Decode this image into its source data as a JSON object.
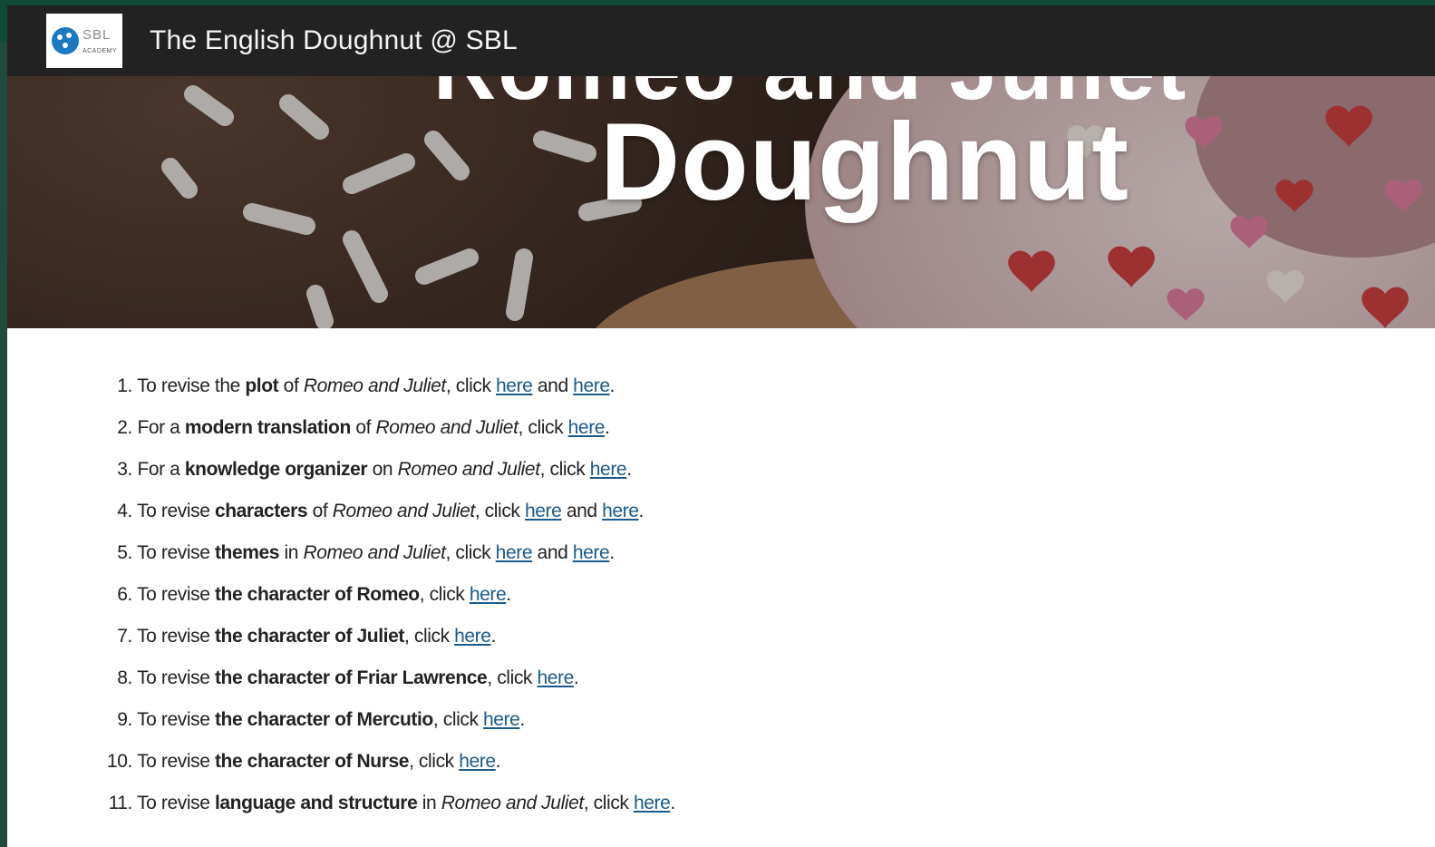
{
  "header": {
    "site_title": "The English Doughnut @ SBL",
    "logo": {
      "name": "SBL",
      "tagline": "ACADEMY"
    }
  },
  "hero": {
    "title": "Doughnut",
    "partial_title": "Romeo and Juliet"
  },
  "colors": {
    "nav_bg": "#222222",
    "accent_green": "#0e4a36",
    "link": "#1a5a8c"
  },
  "revision_list": [
    {
      "number": "1.",
      "parts": [
        "To revise the ",
        "plot",
        " of ",
        "Romeo and Juliet",
        ", click ",
        "here",
        " and ",
        "here",
        "."
      ]
    },
    {
      "number": "2.",
      "parts": [
        "For a ",
        "modern translation",
        " of ",
        "Romeo and Juliet",
        ", click ",
        "here",
        "."
      ]
    },
    {
      "number": "3.",
      "parts": [
        "For a ",
        "knowledge organizer",
        " on ",
        "Romeo and Juliet",
        ", click ",
        "here",
        "."
      ]
    },
    {
      "number": "4.",
      "parts": [
        "To revise ",
        "characters",
        " of ",
        "Romeo and Juliet",
        ", click ",
        "here",
        " and ",
        "here",
        "."
      ]
    },
    {
      "number": "5.",
      "parts": [
        "To revise ",
        "themes",
        " in ",
        "Romeo and Juliet",
        ", click ",
        "here",
        " and ",
        "here",
        "."
      ]
    },
    {
      "number": "6.",
      "parts": [
        "To revise ",
        "the character of Romeo",
        ", click ",
        "here",
        "."
      ]
    },
    {
      "number": "7.",
      "parts": [
        "To revise ",
        "the character of Juliet",
        ", click ",
        "here",
        "."
      ]
    },
    {
      "number": "8.",
      "parts": [
        "To revise ",
        "the character of Friar Lawrence",
        ", click ",
        "here",
        "."
      ]
    },
    {
      "number": "9.",
      "parts": [
        "To revise ",
        "the character of Mercutio",
        ", click ",
        "here",
        "."
      ]
    },
    {
      "number": "10.",
      "parts": [
        "To revise ",
        "the character of Nurse",
        ", click ",
        "here",
        "."
      ]
    },
    {
      "number": "11.",
      "parts": [
        "To revise ",
        "language and structure",
        " in ",
        "Romeo and Juliet",
        ", click ",
        "here",
        "."
      ]
    }
  ]
}
